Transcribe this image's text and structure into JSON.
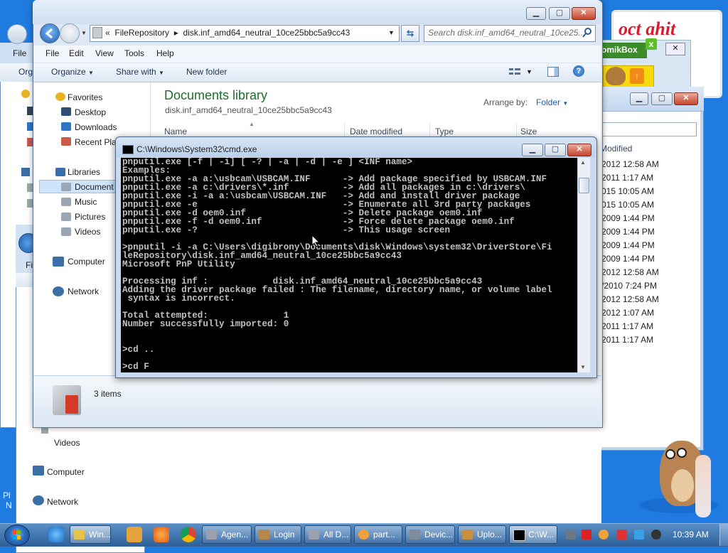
{
  "background": {
    "banner_text": "oct ahit",
    "toolbar_title": "omikBox",
    "back_right": {
      "column_header": "Modified",
      "rows": [
        "2012 12:58 AM",
        "2011 1:17 AM",
        "015 10:05 AM",
        "015 10:05 AM",
        "2009 1:44 PM",
        "2009 1:44 PM",
        "2009 1:44 PM",
        "2009 1:44 PM",
        "2012 12:58 AM",
        "/2010 7:24 PM",
        "2012 12:58 AM",
        "2012 1:07 AM",
        "2011 1:17 AM",
        "2011 1:17 AM"
      ]
    },
    "back_left": {
      "menu_file": "File",
      "organize": "Org",
      "menu_fi": "Fi",
      "videos": "Videos",
      "computer": "Computer",
      "network": "Network",
      "edge_text_1": "Pl",
      "edge_text_2": "N"
    }
  },
  "explorer": {
    "address": {
      "prefix": "«",
      "segment1": "FileRepository",
      "segment2": "disk.inf_amd64_neutral_10ce25bbc5a9cc43"
    },
    "search_placeholder": "Search disk.inf_amd64_neutral_10ce25...",
    "menu": [
      "File",
      "Edit",
      "View",
      "Tools",
      "Help"
    ],
    "commands": {
      "organize": "Organize",
      "share_with": "Share with",
      "new_folder": "New folder"
    },
    "nav": {
      "favorites": "Favorites",
      "desktop": "Desktop",
      "downloads": "Downloads",
      "recent": "Recent Pla",
      "libraries": "Libraries",
      "documents": "Document",
      "music": "Music",
      "pictures": "Pictures",
      "videos": "Videos",
      "computer": "Computer",
      "network": "Network"
    },
    "library_title": "Documents library",
    "library_subtitle": "disk.inf_amd64_neutral_10ce25bbc5a9cc43",
    "arrange_label": "Arrange by:",
    "arrange_value": "Folder",
    "columns": [
      "Name",
      "Date modified",
      "Type",
      "Size"
    ],
    "details": "3 items"
  },
  "cmd": {
    "title": "C:\\Windows\\System32\\cmd.exe",
    "output": "pnputil.exe [-f | -i] [ -? | -a | -d | -e ] <INF name>\nExamples:\npnputil.exe -a a:\\usbcam\\USBCAM.INF      -> Add package specified by USBCAM.INF\npnputil.exe -a c:\\drivers\\*.inf          -> Add all packages in c:\\drivers\\\npnputil.exe -i -a a:\\usbcam\\USBCAM.INF   -> Add and install driver package\npnputil.exe -e                           -> Enumerate all 3rd party packages\npnputil.exe -d oem0.inf                  -> Delete package oem0.inf\npnputil.exe -f -d oem0.inf               -> Force delete package oem0.inf\npnputil.exe -?                           -> This usage screen\n\n>pnputil -i -a C:\\Users\\digibrony\\Documents\\disk\\Windows\\system32\\DriverStore\\Fi\nleRepository\\disk.inf_amd64_neutral_10ce25bbc5a9cc43\nMicrosoft PnP Utility\n\nProcessing inf :            disk.inf_amd64_neutral_10ce25bbc5a9cc43\nAdding the driver package failed : The filename, directory name, or volume label\n syntax is incorrect.\n\nTotal attempted:              1\nNumber successfully imported: 0\n\n\n>cd ..\n\n>cd F"
  },
  "taskbar": {
    "buttons": [
      "Win...",
      "Agen...",
      "Login",
      "All D...",
      "part...",
      "Devic...",
      "Uplo...",
      "C:\\W..."
    ],
    "clock": "10:39 AM"
  },
  "colors": {
    "desktop": "#1f7be0",
    "library_title": "#1f6d2e",
    "console_text": "#c0c0c0",
    "console_bg": "#000000"
  },
  "icons": [
    "back-arrow-icon",
    "forward-arrow-icon",
    "refresh-icon",
    "search-icon",
    "help-icon",
    "views-icon",
    "preview-pane-icon",
    "star-icon",
    "folder-icon",
    "music-note-icon",
    "computer-icon",
    "network-icon",
    "cmd-icon",
    "windows-orb-icon"
  ]
}
